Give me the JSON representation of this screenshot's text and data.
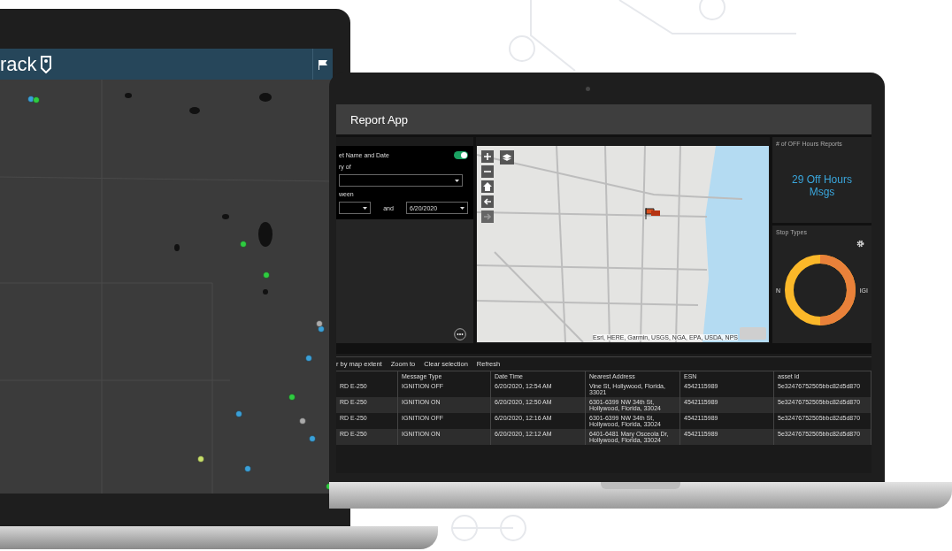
{
  "left_laptop": {
    "logo": "rack"
  },
  "right_laptop": {
    "title": "Report App",
    "filter_panel": {
      "heading": "et Name and Date",
      "toggle": {
        "on": true
      },
      "field_label": "ry of",
      "range_label": "ween",
      "and_label": "and",
      "to": {
        "value": "6/20/2020"
      }
    },
    "map": {
      "attribution": "Esri, HERE, Garmin, USGS, NGA, EPA, USDA, NPS"
    },
    "counter_panel": {
      "title": "# of OFF Hours Reports",
      "value": "29 Off Hours Msgs"
    },
    "stop_types": {
      "title": "Stop Types",
      "left_label": "N",
      "right_label": "IGI"
    },
    "toolbar": [
      "r by map extent",
      "Zoom to",
      "Clear selection",
      "Refresh"
    ],
    "table": {
      "columns": [
        "",
        "Message Type",
        "Date Time",
        "Nearest Address",
        "ESN",
        "asset Id"
      ],
      "rows": [
        [
          "RD E-250",
          "IGNITION OFF",
          "6/20/2020, 12:54 AM",
          "Vine St, Hollywood, Florida, 33021",
          "4542115989",
          "5e32476752505bbc82d5d870"
        ],
        [
          "RD E-250",
          "IGNITION ON",
          "6/20/2020, 12:50 AM",
          "6301-6399 NW 34th St, Hollywood, Florida, 33024",
          "4542115989",
          "5e32476752505bbc82d5d870"
        ],
        [
          "RD E-250",
          "IGNITION OFF",
          "6/20/2020, 12:16 AM",
          "6301-6399 NW 34th St, Hollywood, Florida, 33024",
          "4542115989",
          "5e32476752505bbc82d5d870"
        ],
        [
          "RD E-250",
          "IGNITION ON",
          "6/20/2020, 12:12 AM",
          "6401-6481 Mary Osceola Dr, Hollywood, Florida, 33024",
          "4542115989",
          "5e32476752505bbc82d5d870"
        ]
      ]
    }
  }
}
